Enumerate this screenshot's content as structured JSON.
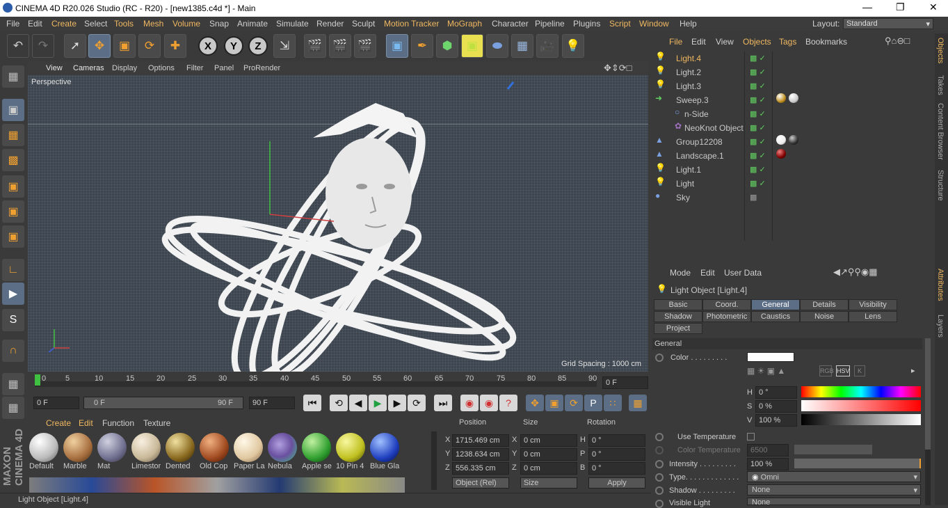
{
  "title": "CINEMA 4D R20.026 Studio (RC - R20) - [new1385.c4d *] - Main",
  "menu": [
    "File",
    "Edit",
    "Create",
    "Select",
    "Tools",
    "Mesh",
    "Volume",
    "Snap",
    "Animate",
    "Simulate",
    "Render",
    "Sculpt",
    "Motion Tracker",
    "MoGraph",
    "Character",
    "Pipeline",
    "Plugins",
    "Script",
    "Window",
    "Help"
  ],
  "layout_label": "Layout:",
  "layout_value": "Standard",
  "axis": {
    "x": "X",
    "y": "Y",
    "z": "Z"
  },
  "viewport": {
    "menu": [
      "View",
      "Cameras",
      "Display",
      "Options",
      "Filter",
      "Panel",
      "ProRender"
    ],
    "label": "Perspective",
    "grid_spacing": "Grid Spacing : 1000 cm"
  },
  "timeline": {
    "ticks": [
      "0",
      "5",
      "10",
      "15",
      "20",
      "25",
      "30",
      "35",
      "40",
      "45",
      "50",
      "55",
      "60",
      "65",
      "70",
      "75",
      "80",
      "85",
      "90"
    ],
    "frame": "0 F"
  },
  "transport": {
    "start": "0 F",
    "range_start": "0 F",
    "range_end": "90 F",
    "end": "90 F"
  },
  "materials": {
    "menu": [
      "Create",
      "Edit",
      "Function",
      "Texture"
    ],
    "items": [
      "Default",
      "Marble",
      "Mat",
      "Limestor",
      "Dented",
      "Old Cop",
      "Paper La",
      "Nebula",
      "Apple se",
      "10 Pin 4",
      "Blue Gla"
    ]
  },
  "coords": {
    "headers": [
      "Position",
      "Size",
      "Rotation"
    ],
    "rows": [
      {
        "a": "X",
        "pos": "1715.469 cm",
        "b": "X",
        "size": "0 cm",
        "c": "H",
        "rot": "0 °"
      },
      {
        "a": "Y",
        "pos": "1238.634 cm",
        "b": "Y",
        "size": "0 cm",
        "c": "P",
        "rot": "0 °"
      },
      {
        "a": "Z",
        "pos": "556.335 cm",
        "b": "Z",
        "size": "0 cm",
        "c": "B",
        "rot": "0 °"
      }
    ],
    "mode": "Object (Rel)",
    "size_mode": "Size",
    "apply": "Apply"
  },
  "objects": {
    "menu": [
      "File",
      "Edit",
      "View",
      "Objects",
      "Tags",
      "Bookmarks"
    ],
    "items": [
      "Light.4",
      "Light.2",
      "Light.3",
      "Sweep.3",
      "n-Side",
      "NeoKnot Object",
      "Group12208",
      "Landscape.1",
      "Light.1",
      "Light",
      "Sky"
    ]
  },
  "attributes": {
    "menu": [
      "Mode",
      "Edit",
      "User Data"
    ],
    "object_label": "Light Object [Light.4]",
    "tabs": [
      "Basic",
      "Coord.",
      "General",
      "Details",
      "Visibility",
      "Shadow",
      "Photometric",
      "Caustics",
      "Noise",
      "Lens",
      "Project"
    ],
    "section": "General",
    "color_label": "Color . . . . . . . . .",
    "h_label": "H",
    "h_value": "0 °",
    "s_label": "S",
    "s_value": "0 %",
    "v_label": "V",
    "v_value": "100 %",
    "use_temp": "Use Temperature",
    "color_temp": "Color Temperature",
    "color_temp_value": "6500",
    "intensity_label": "Intensity . . . . . . . . .",
    "intensity_value": "100 %",
    "type_label": "Type. . . . . . . . . . . . .",
    "type_value": "Omni",
    "shadow_label": "Shadow . . . . . . . . .",
    "shadow_value": "None",
    "visible_label": "Visible Light",
    "visible_value": "None",
    "mode_buttons": [
      "RGB",
      "HSV",
      "K"
    ]
  },
  "right_tabs": [
    "Objects",
    "Takes",
    "Content Browser",
    "Structure",
    "Attributes",
    "Layers"
  ],
  "status": "Light Object [Light.4]",
  "brand": "MAXON CINEMA 4D"
}
